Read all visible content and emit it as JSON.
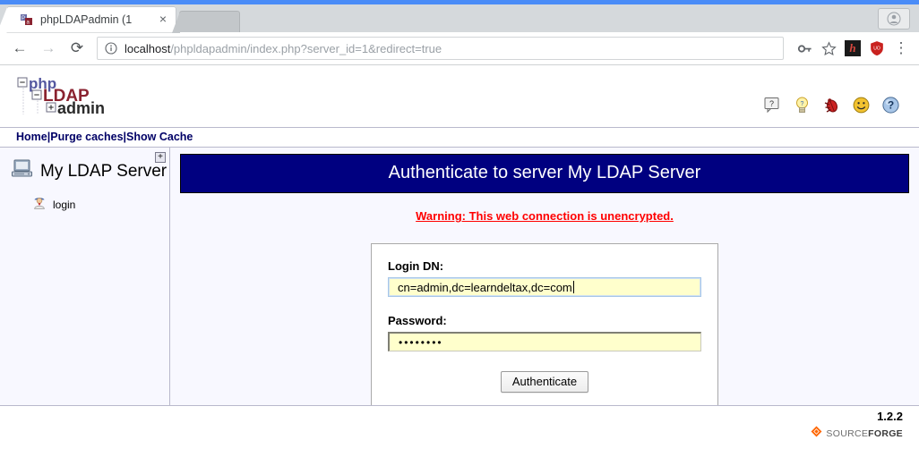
{
  "browser": {
    "tab": {
      "title": "phpLDAPadmin (1",
      "favicon_name": "phpldapadmin-favicon",
      "close_label": "×"
    },
    "toolbar": {
      "back_label": "←",
      "forward_label": "→",
      "reload_label": "⟳",
      "url_host": "localhost",
      "url_path": "/phpldapadmin/index.php?server_id=1&redirect=true",
      "url_full": "localhost/phpldapadmin/index.php?server_id=1&redirect=true",
      "info_icon": "info-circle-icon",
      "key_icon": "key-icon",
      "star_icon": "star-icon",
      "extension_1": "h",
      "extension_2": "ublock-origin-icon",
      "menu_label": "⋮"
    },
    "profile_icon": "profile-avatar-icon"
  },
  "app": {
    "logo": {
      "part1": "php",
      "part2": "LDAP",
      "part3": "admin"
    },
    "header_icons": [
      {
        "name": "help-balloon-icon",
        "title": "?"
      },
      {
        "name": "lightbulb-icon",
        "title": "Hints"
      },
      {
        "name": "bug-icon",
        "title": "Report a bug"
      },
      {
        "name": "smiley-icon",
        "title": "Feedback"
      },
      {
        "name": "question-ball-icon",
        "title": "Help"
      }
    ],
    "nav": {
      "home": "Home",
      "purge": "Purge caches",
      "show_cache": "Show Cache",
      "separator": "|"
    },
    "sidebar": {
      "expand_box": "+",
      "server_icon": "server-computer-icon",
      "server_name": "My LDAP Server",
      "login_icon": "login-user-icon",
      "login_label": "login"
    },
    "main": {
      "title": "Authenticate to server My LDAP Server",
      "warning": "Warning: This web connection is unencrypted.",
      "form": {
        "login_dn_label": "Login DN:",
        "login_dn_value": "cn=admin,dc=learndeltax,dc=com",
        "login_dn_placeholder": "",
        "password_label": "Password:",
        "password_value": "••••••••",
        "password_placeholder": "",
        "submit_label": "Authenticate"
      }
    },
    "footer": {
      "version": "1.2.2",
      "sourceforge_prefix": "SOURCE",
      "sourceforge_suffix": "FORGE",
      "sourceforge_icon": "sourceforge-diamond-icon"
    }
  },
  "colors": {
    "title_bar": "#000080",
    "warning": "#ff0000",
    "input_bg": "#ffffcc",
    "nav_link": "#000066",
    "page_bg": "#f8f8ff",
    "sourceforge_orange": "#ff6600"
  }
}
